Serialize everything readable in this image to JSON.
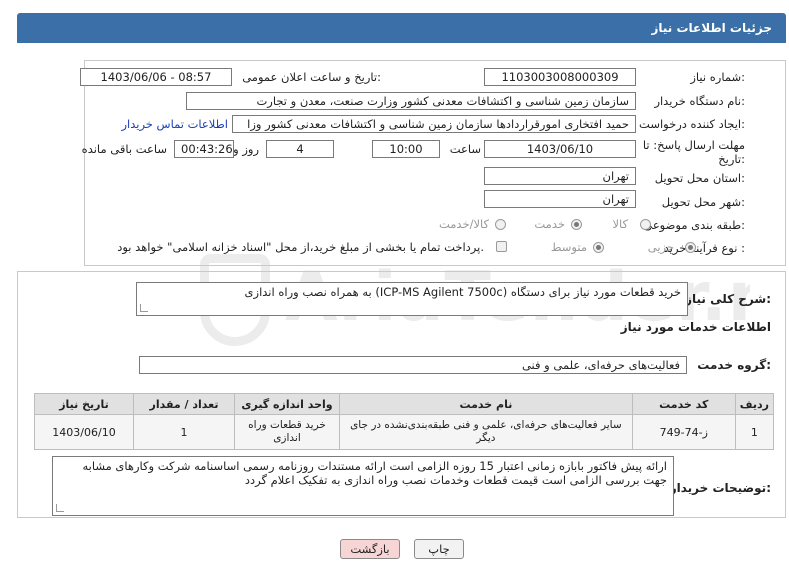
{
  "header": {
    "title": "جزئیات اطلاعات نیاز"
  },
  "form": {
    "need_number": {
      "label": "شماره نیاز:",
      "value": "1103003008000309"
    },
    "announce_datetime": {
      "label": "تاریخ و ساعت اعلان عمومی:",
      "value": "1403/06/06 - 08:57"
    },
    "buyer_org": {
      "label": "نام دستگاه خریدار:",
      "value": "سازمان زمین شناسی و اکتشافات معدنی کشور وزارت صنعت، معدن و تجارت"
    },
    "requester": {
      "label": "ایجاد کننده درخواست:",
      "value": "حمید افتخاری امورقراردادها سازمان زمین شناسی و اکتشافات معدنی کشور وزا",
      "link": "اطلاعات تماس خریدار"
    },
    "deadline": {
      "label": "مهلت ارسال پاسخ: تا تاریخ:",
      "date": "1403/06/10",
      "time_label": "ساعت",
      "time": "10:00",
      "days": "4",
      "days_label": "روز و",
      "remaining": "00:43:26",
      "remaining_label": "ساعت باقی مانده"
    },
    "province": {
      "label": "استان محل تحویل:",
      "value": "تهران"
    },
    "city": {
      "label": "شهر محل تحویل:",
      "value": "تهران"
    },
    "category": {
      "label": "طبقه بندی موضوعی:",
      "options": [
        "کالا",
        "خدمت",
        "کالا/خدمت"
      ],
      "selected": "خدمت"
    },
    "process": {
      "label": "نوع فرآیند خرید :",
      "options": [
        "جزیی",
        "متوسط"
      ],
      "selected": "جزیی",
      "payment_note": "پرداخت تمام یا بخشی از مبلغ خرید،از محل \"اسناد خزانه اسلامی\" خواهد بود."
    }
  },
  "summary": {
    "label": "شرح کلی نیاز:",
    "value": "خرید قطعات مورد نیاز برای دستگاه (ICP-MS Agilent 7500c) به همراه نصب وراه اندازی"
  },
  "services": {
    "section_title": "اطلاعات خدمات مورد نیاز",
    "group_label": "گروه خدمت:",
    "group_value": "فعالیت‌های حرفه‌ای، علمی و فنی",
    "columns": [
      "ردیف",
      "کد خدمت",
      "نام خدمت",
      "واحد اندازه گیری",
      "تعداد / مقدار",
      "تاریخ نیاز"
    ],
    "rows": [
      {
        "index": "1",
        "code": "ز-74-749",
        "name": "سایر فعالیت‌های حرفه‌ای، علمی و فنی طبقه‌بندی‌نشده در جای دیگر",
        "unit": "خرید قطعات وراه اندازی",
        "qty": "1",
        "date": "1403/06/10"
      }
    ]
  },
  "buyer_notes": {
    "label": "توضیحات خریدار:",
    "value": "ارائه پیش فاکتور بابازه زمانی اعتبار 15 روزه الزامی است ارائه مستندات روزنامه رسمی اساسنامه شرکت وکارهای مشابه جهت بررسی الزامی است  قیمت قطعات وخدمات نصب وراه اندازی به تفکیک اعلام گردد"
  },
  "buttons": {
    "print": "چاپ",
    "back": "بازگشت"
  },
  "watermark": "AriaTender.neT",
  "colors": {
    "header_bg": "#3a6fa8",
    "link": "#1a3fb5",
    "back_btn_bg": "#f7d5d5"
  }
}
